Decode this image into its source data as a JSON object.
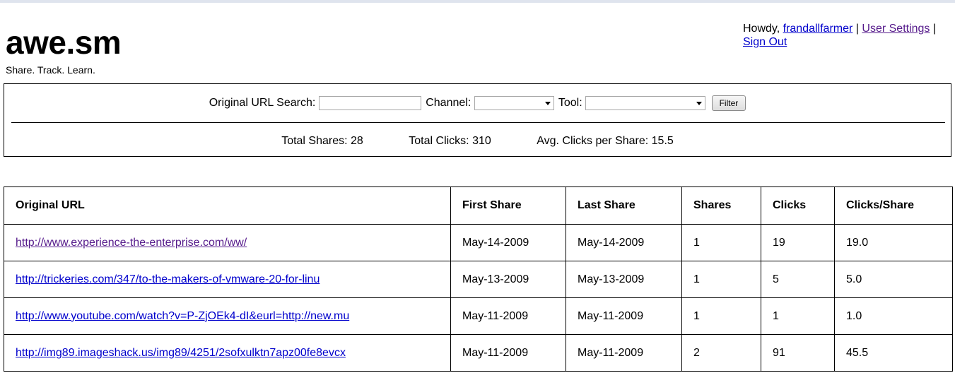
{
  "header": {
    "logo": "awe.sm",
    "tagline": "Share. Track. Learn.",
    "greeting": "Howdy,",
    "username": "frandallfarmer",
    "separator": "|",
    "user_settings": "User Settings",
    "sign_out": "Sign Out"
  },
  "filter": {
    "url_search_label": "Original URL Search:",
    "url_search_value": "",
    "channel_label": "Channel:",
    "channel_selected": "",
    "tool_label": "Tool:",
    "tool_selected": "",
    "filter_button": "Filter"
  },
  "stats": {
    "total_shares": "Total Shares: 28",
    "total_clicks": "Total Clicks: 310",
    "avg_clicks": "Avg. Clicks per Share: 15.5"
  },
  "table": {
    "headers": [
      "Original URL",
      "First Share",
      "Last Share",
      "Shares",
      "Clicks",
      "Clicks/Share"
    ],
    "rows": [
      {
        "url": "http://www.experience-the-enterprise.com/ww/",
        "first": "May-14-2009",
        "last": "May-14-2009",
        "shares": "1",
        "clicks": "19",
        "cps": "19.0"
      },
      {
        "url": "http://trickeries.com/347/to-the-makers-of-vmware-20-for-linu",
        "first": "May-13-2009",
        "last": "May-13-2009",
        "shares": "1",
        "clicks": "5",
        "cps": "5.0"
      },
      {
        "url": "http://www.youtube.com/watch?v=P-ZjOEk4-dI&eurl=http://new.mu",
        "first": "May-11-2009",
        "last": "May-11-2009",
        "shares": "1",
        "clicks": "1",
        "cps": "1.0"
      },
      {
        "url": "http://img89.imageshack.us/img89/4251/2sofxulktn7apz00fe8evcx",
        "first": "May-11-2009",
        "last": "May-11-2009",
        "shares": "2",
        "clicks": "91",
        "cps": "45.5"
      }
    ]
  }
}
